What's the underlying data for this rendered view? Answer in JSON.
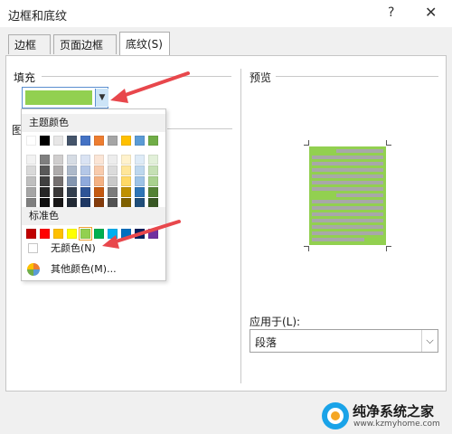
{
  "window": {
    "title": "边框和底纹",
    "help": "?",
    "close": "✕"
  },
  "tabs": [
    {
      "label": "边框(B)"
    },
    {
      "label": "页面边框(P)"
    },
    {
      "label": "底纹(S)"
    }
  ],
  "fill": {
    "label": "填充",
    "current_color": "#92d050"
  },
  "pattern_label_partial": "图",
  "color_popup": {
    "theme_header": "主题颜色",
    "standard_header": "标准色",
    "no_color": "无颜色(N)",
    "more_colors": "其他颜色(M)...",
    "theme_colors": [
      [
        "#ffffff",
        "#f2f2f2",
        "#d9d9d9",
        "#bfbfbf",
        "#a6a6a6",
        "#7f7f7f"
      ],
      [
        "#000000",
        "#7f7f7f",
        "#595959",
        "#404040",
        "#262626",
        "#0d0d0d"
      ],
      [
        "#e7e6e6",
        "#d0cece",
        "#aeabab",
        "#757070",
        "#3a3838",
        "#171616"
      ],
      [
        "#44546a",
        "#d6dce4",
        "#adb9ca",
        "#8496b0",
        "#333f4f",
        "#222a35"
      ],
      [
        "#4472c4",
        "#dae3f3",
        "#b4c7e7",
        "#8faadc",
        "#2f5597",
        "#1f3864"
      ],
      [
        "#ed7d31",
        "#fbe5d6",
        "#f8cbad",
        "#f4b183",
        "#c55a11",
        "#843c0c"
      ],
      [
        "#a5a5a5",
        "#ededed",
        "#dbdbdb",
        "#c9c9c9",
        "#7b7b7b",
        "#525252"
      ],
      [
        "#ffc000",
        "#fff2cc",
        "#ffe699",
        "#ffd966",
        "#bf9000",
        "#7f6000"
      ],
      [
        "#5b9bd5",
        "#deebf7",
        "#bdd7ee",
        "#9dc3e6",
        "#2e75b6",
        "#1f4e79"
      ],
      [
        "#70ad47",
        "#e2f0d9",
        "#c5e0b4",
        "#a9d18e",
        "#548235",
        "#385723"
      ]
    ],
    "standard_colors": [
      "#c00000",
      "#ff0000",
      "#ffc000",
      "#ffff00",
      "#92d050",
      "#00b050",
      "#00b0f0",
      "#0070c0",
      "#002060",
      "#7030a0"
    ]
  },
  "preview": {
    "label": "预览"
  },
  "apply_to": {
    "label": "应用于(L):",
    "value": "段落"
  },
  "watermark": {
    "title": "纯净系统之家",
    "url": "www.kzmyhome.com"
  },
  "accent": "#e8474c"
}
